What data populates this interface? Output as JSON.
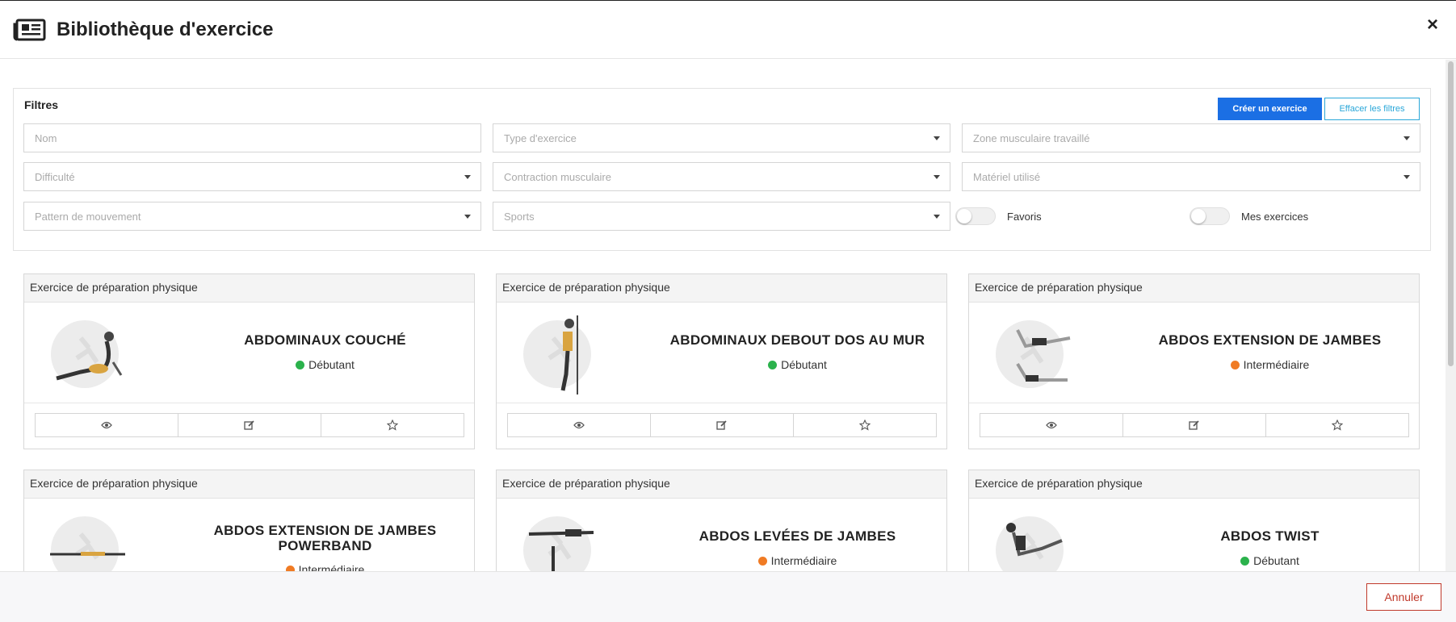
{
  "header": {
    "title": "Bibliothèque d'exercice",
    "close": "×"
  },
  "filters": {
    "title": "Filtres",
    "create_button": "Créer un exercice",
    "clear_button": "Effacer les filtres",
    "fields": {
      "nom": "Nom",
      "type": "Type d'exercice",
      "zone": "Zone musculaire travaillé",
      "difficulte": "Difficulté",
      "contraction": "Contraction musculaire",
      "materiel": "Matériel utilisé",
      "pattern": "Pattern de mouvement",
      "sports": "Sports"
    },
    "toggles": {
      "favoris": "Favoris",
      "mes_exercices": "Mes exercices"
    }
  },
  "exercises": [
    {
      "category": "Exercice de préparation physique",
      "name": "ABDOMINAUX COUCHÉ",
      "difficulty": "Débutant",
      "difficulty_color": "#2bb24c"
    },
    {
      "category": "Exercice de préparation physique",
      "name": "ABDOMINAUX DEBOUT DOS AU MUR",
      "difficulty": "Débutant",
      "difficulty_color": "#2bb24c"
    },
    {
      "category": "Exercice de préparation physique",
      "name": "ABDOS EXTENSION DE JAMBES",
      "difficulty": "Intermédiaire",
      "difficulty_color": "#f07b24"
    },
    {
      "category": "Exercice de préparation physique",
      "name": "ABDOS EXTENSION DE JAMBES POWERBAND",
      "difficulty": "Intermédiaire",
      "difficulty_color": "#f07b24"
    },
    {
      "category": "Exercice de préparation physique",
      "name": "ABDOS LEVÉES DE JAMBES",
      "difficulty": "Intermédiaire",
      "difficulty_color": "#f07b24"
    },
    {
      "category": "Exercice de préparation physique",
      "name": "ABDOS TWIST",
      "difficulty": "Débutant",
      "difficulty_color": "#2bb24c"
    }
  ],
  "card_actions": [
    "eye-icon",
    "edit-icon",
    "star-icon"
  ],
  "footer": {
    "cancel_button": "Annuler"
  },
  "colors": {
    "primary": "#1b6fe4",
    "info": "#2aa7d9",
    "danger": "#c0392b"
  }
}
